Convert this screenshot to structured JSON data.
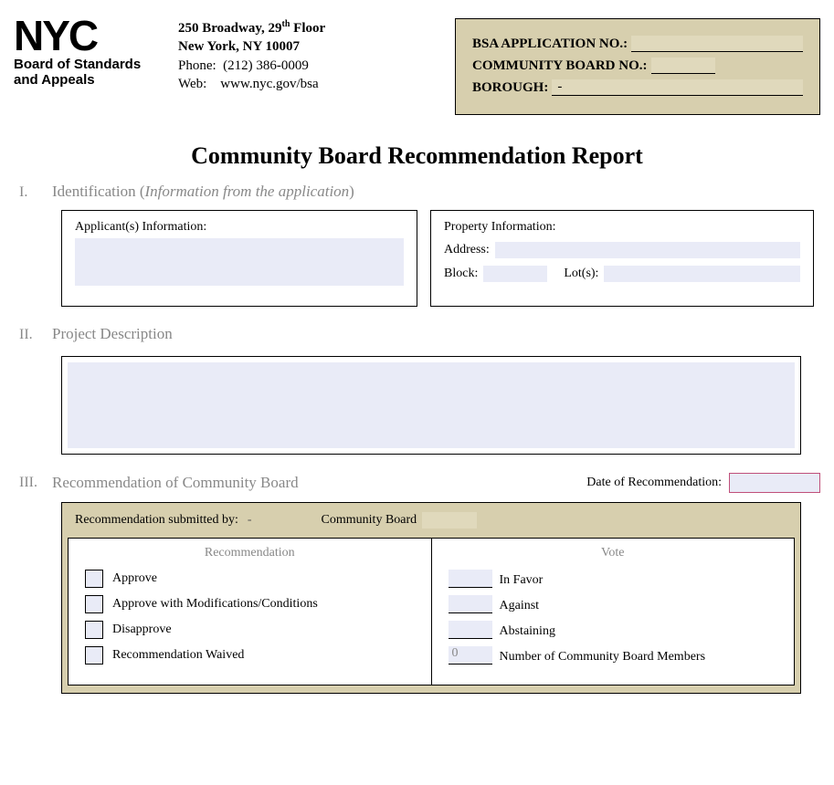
{
  "logo": {
    "main": "NYC",
    "sub1": "Board of Standards",
    "sub2": "and Appeals"
  },
  "address": {
    "line1a": "250 Broadway, 29",
    "line1sup": "th",
    "line1b": " Floor",
    "line2": "New York, NY  10007",
    "phone_label": "Phone:",
    "phone": "(212) 386-0009",
    "web_label": "Web:",
    "web": "www.nyc.gov/bsa"
  },
  "appbox": {
    "bsa_label": "BSA APPLICATION NO.:",
    "cb_label": "COMMUNITY BOARD NO.:",
    "boro_label": "BOROUGH:",
    "boro_value": "-"
  },
  "title": "Community Board Recommendation Report",
  "sec1": {
    "num": "I.",
    "label_a": "Identification (",
    "label_i": "Information from the application",
    "label_b": ")"
  },
  "boxL": {
    "title": "Applicant(s) Information:"
  },
  "boxR": {
    "title": "Property Information:",
    "addr": "Address:",
    "block": "Block:",
    "lot": "Lot(s):"
  },
  "sec2": {
    "num": "II.",
    "label": "Project Description"
  },
  "sec3": {
    "num": "III.",
    "label": "Recommendation of Community Board",
    "date_label": "Date of Recommendation:"
  },
  "rec_top": {
    "a": "Recommendation submitted by:",
    "dash": "-",
    "b": "Community Board"
  },
  "cols": {
    "rec": "Recommendation",
    "vote": "Vote"
  },
  "opts": {
    "approve": "Approve",
    "approve_mod": "Approve with Modifications/Conditions",
    "disapprove": "Disapprove",
    "waived": "Recommendation Waived"
  },
  "votes": {
    "favor": "In Favor",
    "against": "Against",
    "abstain": "Abstaining",
    "total_val": "0",
    "total": "Number of Community Board Members"
  }
}
